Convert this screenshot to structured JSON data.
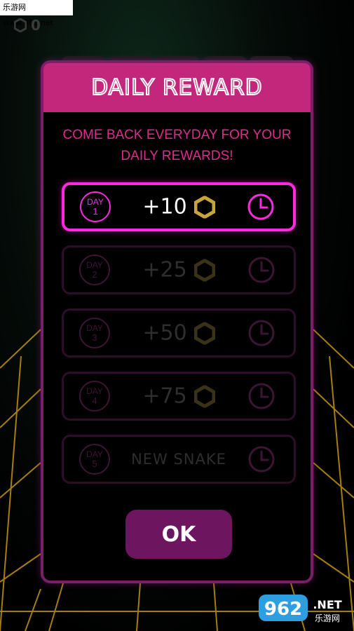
{
  "watermark": {
    "text": "乐游网 www.962.net"
  },
  "hud": {
    "coins": "0",
    "coin_icon": "hexagon-icon"
  },
  "dialog": {
    "title": "DAILY REWARD",
    "subtitle_line1": "COME BACK EVERYDAY FOR YOUR",
    "subtitle_line2": "DAILY REWARDS!",
    "rewards": [
      {
        "day_word": "DAY",
        "day_num": "1",
        "amount": "+10",
        "icon": "hexagon-coin-icon",
        "status_icon": "clock-icon",
        "active": true
      },
      {
        "day_word": "DAY",
        "day_num": "2",
        "amount": "+25",
        "icon": "hexagon-coin-icon",
        "status_icon": "clock-icon",
        "active": false
      },
      {
        "day_word": "DAY",
        "day_num": "3",
        "amount": "+50",
        "icon": "hexagon-coin-icon",
        "status_icon": "clock-icon",
        "active": false
      },
      {
        "day_word": "DAY",
        "day_num": "4",
        "amount": "+75",
        "icon": "hexagon-coin-icon",
        "status_icon": "clock-icon",
        "active": false
      },
      {
        "day_word": "DAY",
        "day_num": "5",
        "amount": "NEW SNAKE",
        "icon": "",
        "status_icon": "clock-icon",
        "active": false
      }
    ],
    "ok_label": "OK"
  },
  "brand": {
    "number": "962",
    "suffix": ".NET",
    "cn": "乐游网"
  },
  "colors": {
    "header": "#c2277b",
    "accent_active": "#ff2ae0",
    "ok_button": "#6e1560",
    "coin_gold": "#c9a43a",
    "grid_line": "#c89a10"
  }
}
